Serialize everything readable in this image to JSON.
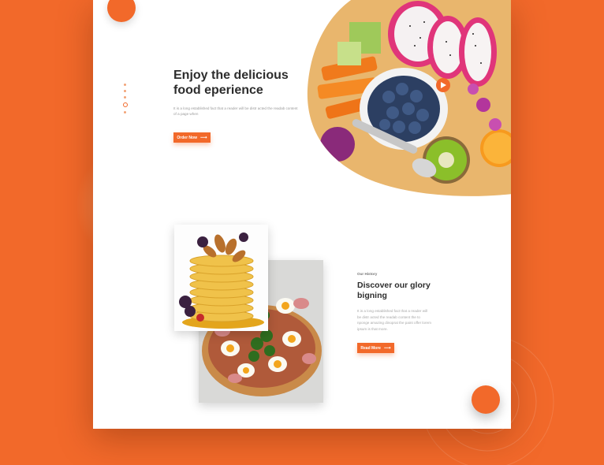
{
  "hero": {
    "title": "Enjoy the delicious food eperience",
    "description": "It is a long established fact that a reader will be distr acted the readab content of a page when",
    "order_button": "Order Now",
    "arrow": "⟶",
    "pager_dots": 5,
    "active_dot": 4
  },
  "history": {
    "label": "Our History",
    "title": "Discover our glory bigning",
    "description": "It is a long established fact that a reader will be distr acted the readab content the to nponge amazing dinoprat the paint offer lorem ipsum is that more.",
    "read_button": "Read More",
    "arrow": "⟶"
  },
  "colors": {
    "accent": "#f2692a",
    "title": "#2d2d2d",
    "body_text": "#9a9a9a"
  },
  "icons": {
    "top_circle": "circle-decoration-icon",
    "fab": "floating-action-icon"
  }
}
